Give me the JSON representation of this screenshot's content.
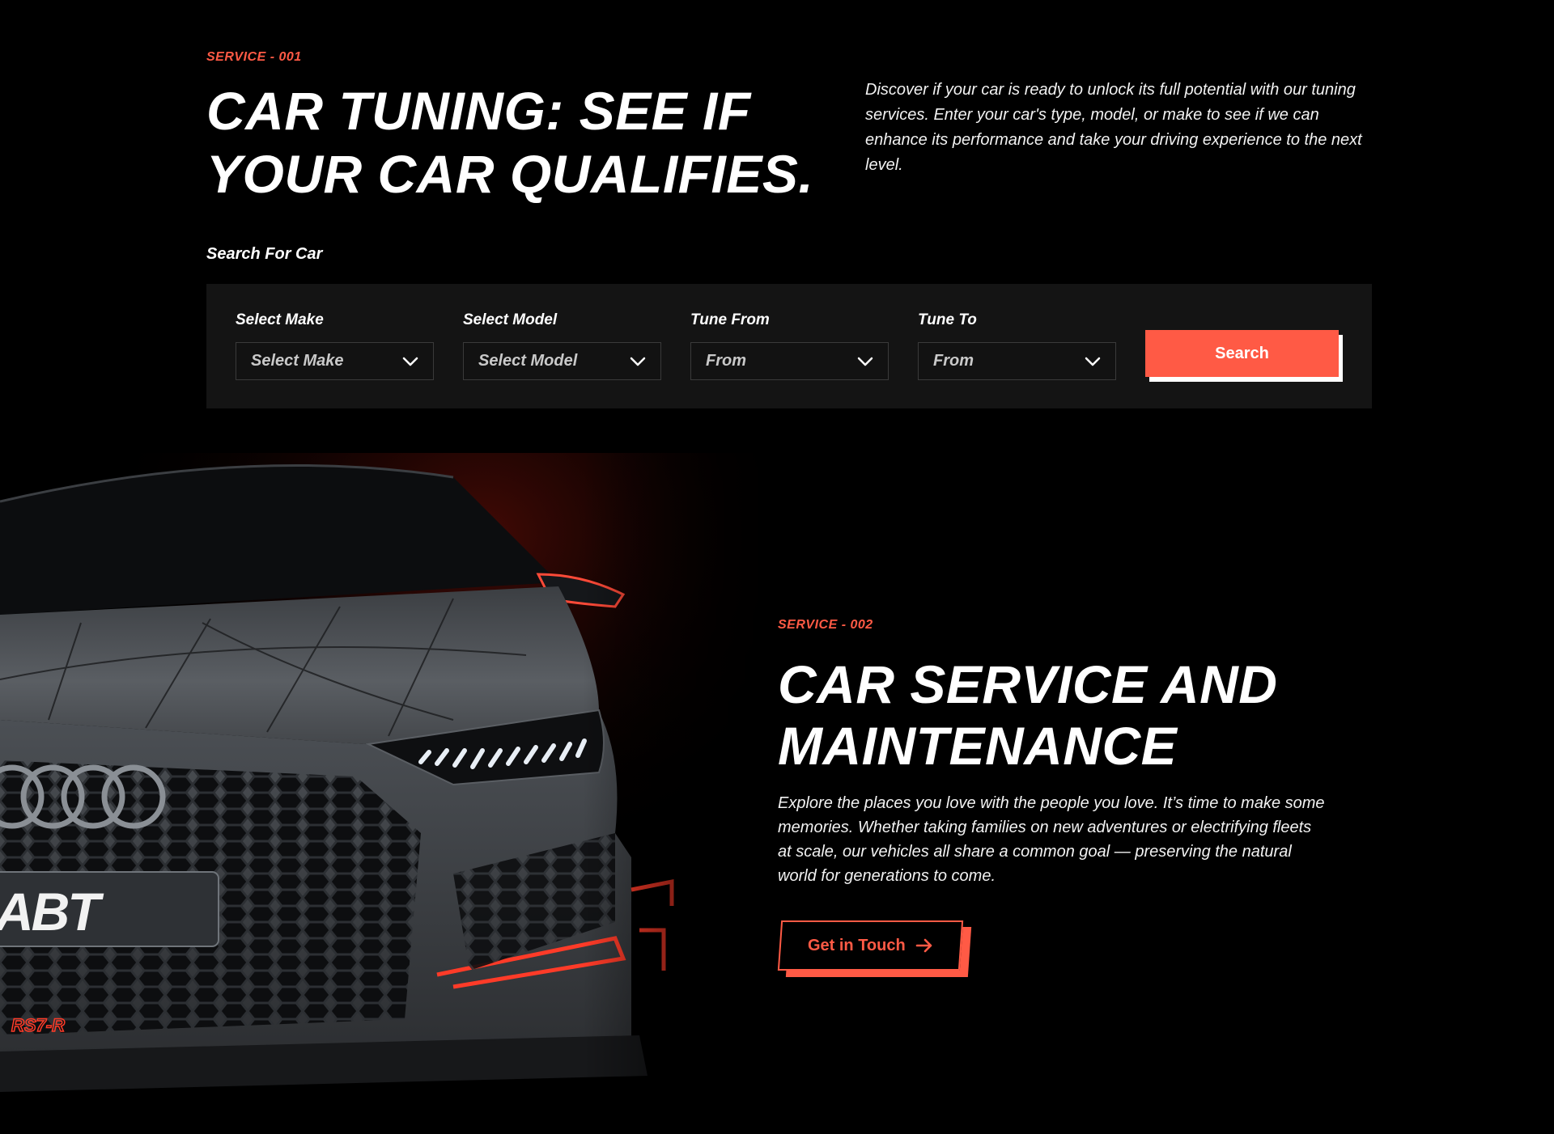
{
  "tuning": {
    "eyebrow": "SERVICE - 001",
    "title_line1": "CAR TUNING: SEE IF",
    "title_line2": "YOUR CAR QUALIFIES.",
    "intro": "Discover if your car is ready to unlock its full potential with our tuning services. Enter your car's type, model, or make to see if we can enhance its performance and take your driving experience to the next level.",
    "search_label": "Search For Car",
    "fields": [
      {
        "label": "Select Make",
        "value": "Select Make"
      },
      {
        "label": "Select Model",
        "value": "Select Model"
      },
      {
        "label": "Tune From",
        "value": "From"
      },
      {
        "label": "Tune To",
        "value": "From"
      }
    ],
    "search_button": "Search"
  },
  "service": {
    "eyebrow": "SERVICE - 002",
    "title_line1": "CAR SERVICE AND",
    "title_line2": "MAINTENANCE",
    "description": "Explore the places you love with the people you love. It’s time to make some memories. Whether taking families on new adventures or electrifying fleets at scale, our vehicles all share a common goal — preserving the natural world for generations to come.",
    "cta": "Get in Touch",
    "image": {
      "plate_text": "ABT",
      "badge_text": "RS7-R"
    }
  },
  "colors": {
    "accent": "#ff5a45",
    "background": "#000000",
    "panel": "#141414"
  }
}
